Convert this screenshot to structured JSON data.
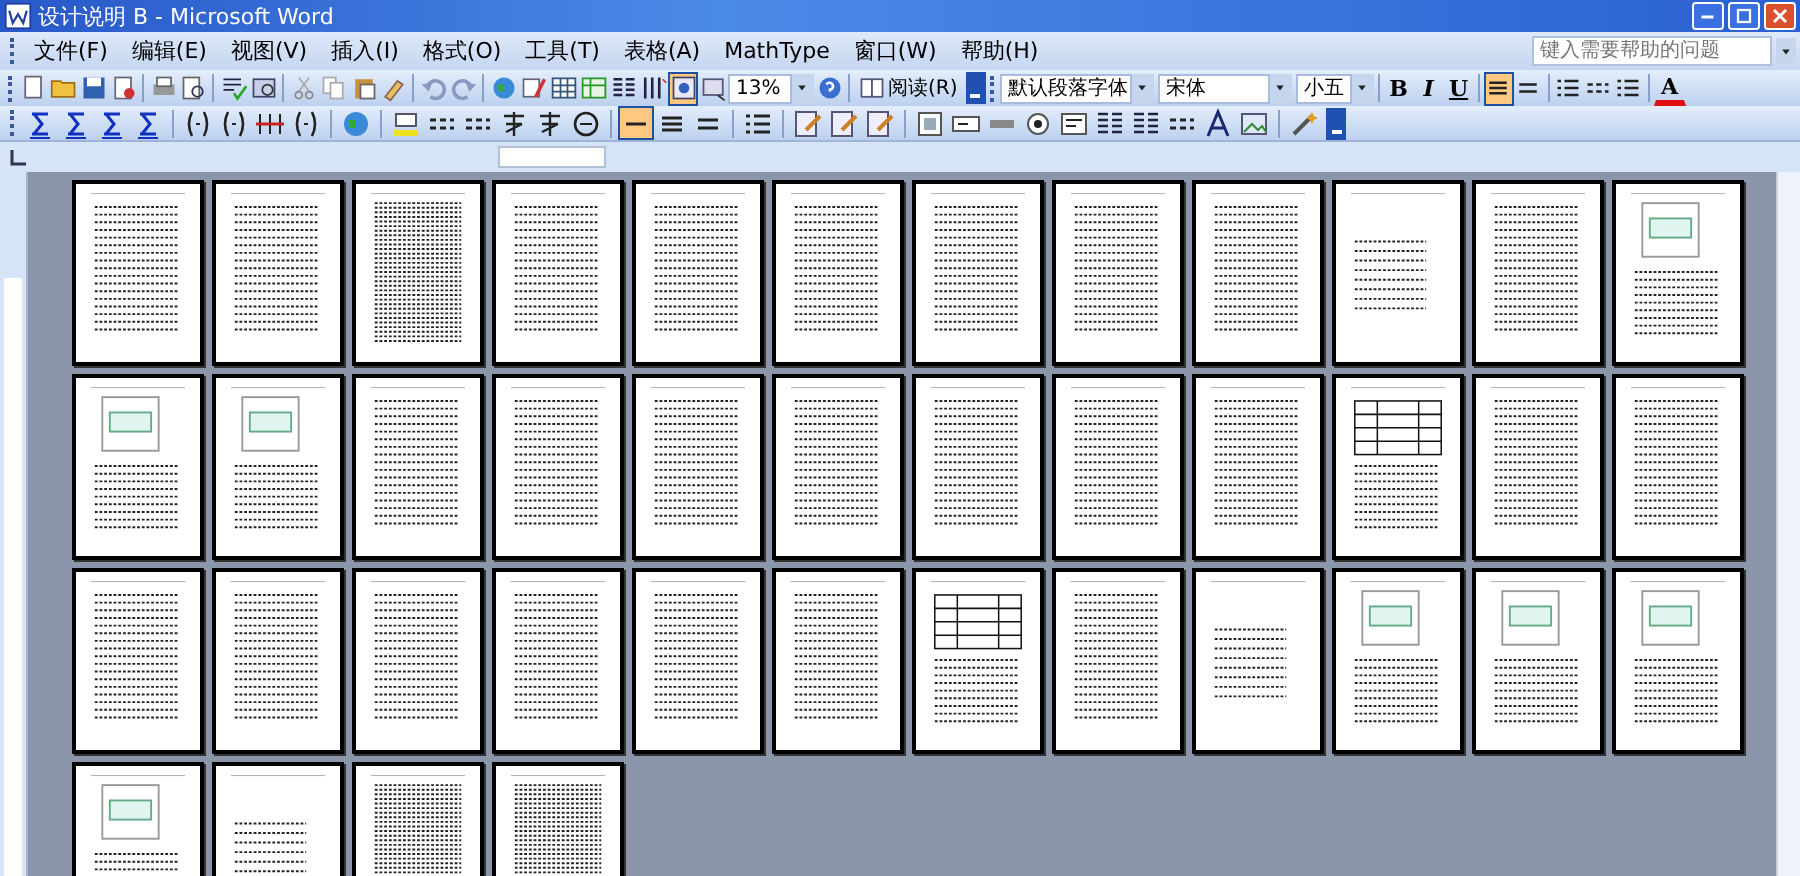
{
  "window": {
    "title": "设计说明 B - Microsoft Word"
  },
  "menu": [
    "文件(F)",
    "编辑(E)",
    "视图(V)",
    "插入(I)",
    "格式(O)",
    "工具(T)",
    "表格(A)",
    "MathType",
    "窗口(W)",
    "帮助(H)"
  ],
  "help_search": {
    "placeholder": "键入需要帮助的问题"
  },
  "standard_toolbar": {
    "buttons": [
      {
        "pressed": false
      },
      {
        "pressed": false
      },
      {
        "pressed": false
      },
      {
        "pressed": false
      },
      {
        "pressed": false
      },
      {
        "pressed": false
      },
      {
        "pressed": false
      },
      {
        "pressed": false
      },
      {
        "pressed": false
      },
      {
        "pressed": false
      },
      {
        "pressed": false
      },
      {
        "pressed": false
      },
      {
        "pressed": false
      },
      {
        "pressed": false
      },
      {
        "pressed": false
      },
      {
        "pressed": false
      },
      {
        "pressed": false
      },
      {
        "pressed": false
      },
      {
        "pressed": false
      },
      {
        "pressed": false
      },
      {
        "pressed": true
      },
      {
        "pressed": false
      }
    ],
    "zoom": "13%",
    "read_button": "阅读(R)"
  },
  "formatting_toolbar": {
    "style": "默认段落字体",
    "font": "宋体",
    "size": "小五",
    "format_buttons": [
      {
        "label": "B",
        "pressed": false
      },
      {
        "label": "I",
        "pressed": false
      },
      {
        "label": "U",
        "pressed": false
      }
    ],
    "align_buttons": [
      {
        "pressed": true
      },
      {
        "pressed": false
      }
    ],
    "font_color": "A"
  },
  "equation_toolbar": {
    "buttons": [
      {
        "pressed": false
      },
      {
        "pressed": false
      },
      {
        "pressed": false
      },
      {
        "pressed": false
      },
      {
        "pressed": false
      },
      {
        "pressed": false
      },
      {
        "pressed": false
      },
      {
        "pressed": false
      },
      {
        "pressed": false
      },
      {
        "pressed": false
      },
      {
        "pressed": false
      },
      {
        "pressed": false
      },
      {
        "pressed": false
      },
      {
        "pressed": false
      },
      {
        "pressed": false
      },
      {
        "pressed": true
      },
      {
        "pressed": false
      },
      {
        "pressed": false
      },
      {
        "pressed": false
      },
      {
        "pressed": false
      },
      {
        "pressed": false
      },
      {
        "pressed": false
      },
      {
        "pressed": false
      },
      {
        "pressed": false
      },
      {
        "pressed": false
      },
      {
        "pressed": false
      },
      {
        "pressed": false
      },
      {
        "pressed": false
      },
      {
        "pressed": false
      },
      {
        "pressed": false
      }
    ]
  },
  "pages": [
    {
      "kind": "text"
    },
    {
      "kind": "text"
    },
    {
      "kind": "dense"
    },
    {
      "kind": "text"
    },
    {
      "kind": "text"
    },
    {
      "kind": "text"
    },
    {
      "kind": "text"
    },
    {
      "kind": "text"
    },
    {
      "kind": "text"
    },
    {
      "kind": "sparse"
    },
    {
      "kind": "text"
    },
    {
      "kind": "figure"
    },
    {
      "kind": "figure"
    },
    {
      "kind": "figure"
    },
    {
      "kind": "text"
    },
    {
      "kind": "text"
    },
    {
      "kind": "text"
    },
    {
      "kind": "text"
    },
    {
      "kind": "text"
    },
    {
      "kind": "text"
    },
    {
      "kind": "text"
    },
    {
      "kind": "table"
    },
    {
      "kind": "text"
    },
    {
      "kind": "text"
    },
    {
      "kind": "text"
    },
    {
      "kind": "text"
    },
    {
      "kind": "text"
    },
    {
      "kind": "text"
    },
    {
      "kind": "text"
    },
    {
      "kind": "text"
    },
    {
      "kind": "table"
    },
    {
      "kind": "text"
    },
    {
      "kind": "sparse"
    },
    {
      "kind": "figure"
    },
    {
      "kind": "figure"
    },
    {
      "kind": "figure"
    },
    {
      "kind": "figure"
    },
    {
      "kind": "sparse"
    },
    {
      "kind": "dense"
    },
    {
      "kind": "dense"
    }
  ]
}
